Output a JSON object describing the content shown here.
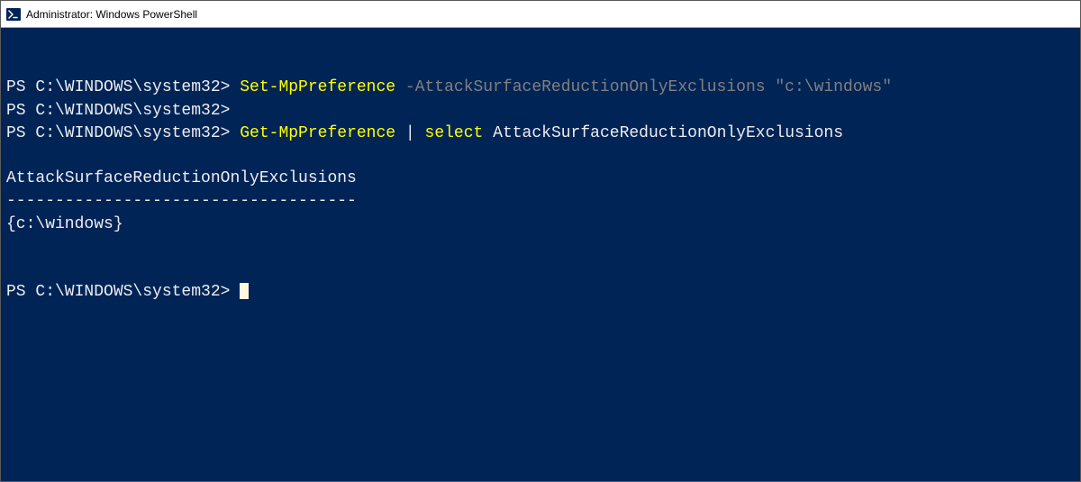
{
  "window": {
    "title": "Administrator: Windows PowerShell",
    "icon": "powershell-icon"
  },
  "terminal": {
    "lines": [
      {
        "type": "blank"
      },
      {
        "type": "blank"
      },
      {
        "type": "command",
        "prompt": "PS C:\\WINDOWS\\system32> ",
        "segments": [
          {
            "class": "cmdlet",
            "text": "Set-MpPreference"
          },
          {
            "class": "plain",
            "text": " "
          },
          {
            "class": "param",
            "text": "-AttackSurfaceReductionOnlyExclusions"
          },
          {
            "class": "plain",
            "text": " "
          },
          {
            "class": "paramval",
            "text": "\"c:\\windows\""
          }
        ]
      },
      {
        "type": "command",
        "prompt": "PS C:\\WINDOWS\\system32> ",
        "segments": []
      },
      {
        "type": "command",
        "prompt": "PS C:\\WINDOWS\\system32> ",
        "segments": [
          {
            "class": "cmdlet",
            "text": "Get-MpPreference"
          },
          {
            "class": "plain",
            "text": " "
          },
          {
            "class": "pipe",
            "text": "|"
          },
          {
            "class": "plain",
            "text": " "
          },
          {
            "class": "keyword",
            "text": "select"
          },
          {
            "class": "plain",
            "text": " "
          },
          {
            "class": "arg",
            "text": "AttackSurfaceReductionOnlyExclusions"
          }
        ]
      },
      {
        "type": "blank"
      },
      {
        "type": "output",
        "text": "AttackSurfaceReductionOnlyExclusions"
      },
      {
        "type": "output",
        "text": "------------------------------------"
      },
      {
        "type": "output",
        "text": "{c:\\windows}"
      },
      {
        "type": "blank"
      },
      {
        "type": "blank"
      },
      {
        "type": "command",
        "prompt": "PS C:\\WINDOWS\\system32> ",
        "segments": [],
        "cursor": true
      }
    ]
  }
}
